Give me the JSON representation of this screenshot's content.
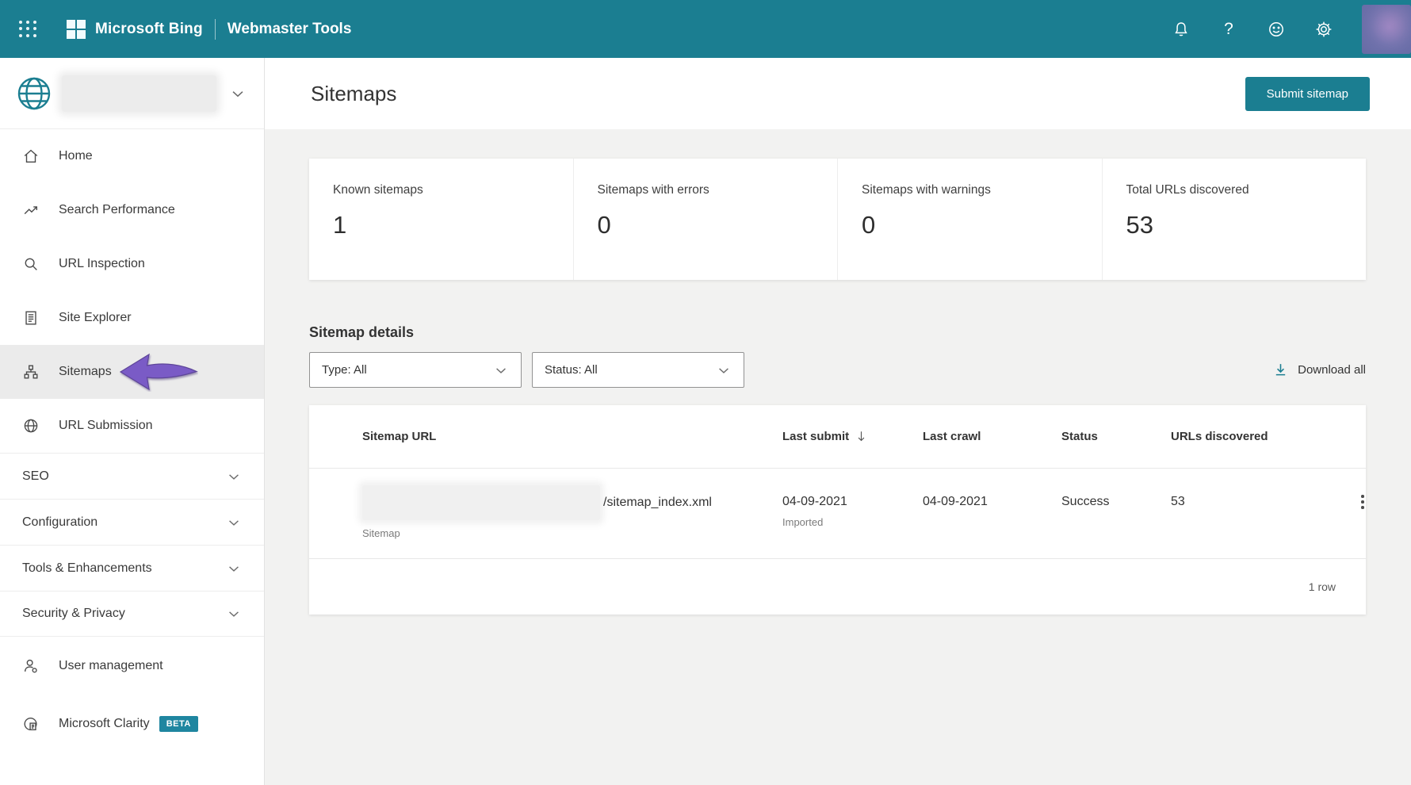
{
  "colors": {
    "header_bg": "#1b7e91",
    "accent": "#1b7e91",
    "active_nav_bg": "#ebebeb",
    "page_bg": "#f2f2f1",
    "annotation_arrow": "#7a5bc6",
    "beta_badge_bg": "#1f86a0"
  },
  "header": {
    "brand": "Microsoft Bing",
    "product": "Webmaster Tools",
    "icons": [
      "waffle-menu-icon",
      "notifications-bell-icon",
      "help-icon",
      "feedback-smiley-icon",
      "settings-gear-icon",
      "account-avatar"
    ]
  },
  "sidebar": {
    "site_selector": {
      "icon": "globe-icon",
      "site_name_redacted": true
    },
    "nav": [
      {
        "label": "Home",
        "icon": "home-icon"
      },
      {
        "label": "Search Performance",
        "icon": "trend-up-icon"
      },
      {
        "label": "URL Inspection",
        "icon": "magnifier-icon"
      },
      {
        "label": "Site Explorer",
        "icon": "document-list-icon"
      },
      {
        "label": "Sitemaps",
        "icon": "org-chart-icon",
        "active": true
      },
      {
        "label": "URL Submission",
        "icon": "globe-icon"
      }
    ],
    "groups": [
      {
        "label": "SEO"
      },
      {
        "label": "Configuration"
      },
      {
        "label": "Tools & Enhancements"
      },
      {
        "label": "Security & Privacy"
      }
    ],
    "bottom": [
      {
        "label": "User management",
        "icon": "person-icon"
      },
      {
        "label": "Microsoft Clarity",
        "icon": "clarity-icon",
        "badge": "BETA"
      }
    ]
  },
  "main": {
    "title": "Sitemaps",
    "submit_button": "Submit sitemap",
    "stats": [
      {
        "label": "Known sitemaps",
        "value": "1"
      },
      {
        "label": "Sitemaps with errors",
        "value": "0"
      },
      {
        "label": "Sitemaps with warnings",
        "value": "0"
      },
      {
        "label": "Total URLs discovered",
        "value": "53"
      }
    ],
    "details": {
      "heading": "Sitemap details",
      "filters": [
        {
          "value": "Type: All"
        },
        {
          "value": "Status: All"
        }
      ],
      "download_all": "Download all"
    },
    "table": {
      "columns": [
        "Sitemap URL",
        "Last submit",
        "Last crawl",
        "Status",
        "URLs discovered"
      ],
      "sorted_column": "Last submit",
      "rows": [
        {
          "domain_redacted": true,
          "url_suffix": "/sitemap_index.xml",
          "type": "Sitemap",
          "last_submit": "04-09-2021",
          "last_submit_note": "Imported",
          "last_crawl": "04-09-2021",
          "status": "Success",
          "urls_discovered": "53"
        }
      ],
      "footer": "1 row"
    }
  }
}
